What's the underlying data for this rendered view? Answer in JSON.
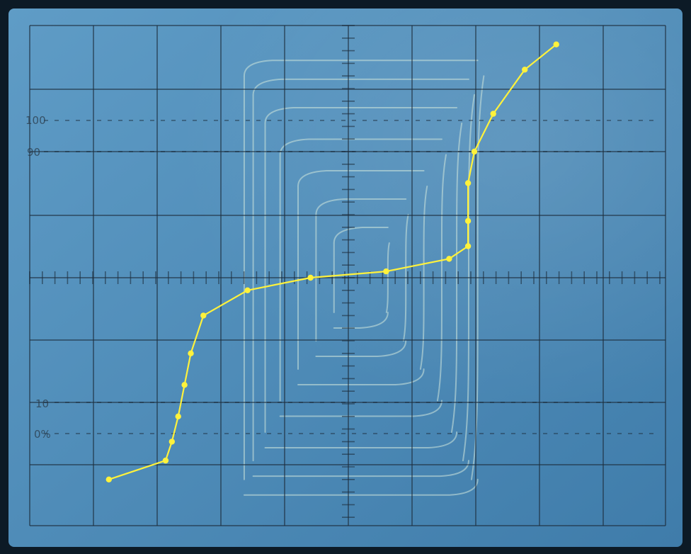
{
  "screen": {
    "labels": {
      "hundred": "100",
      "ninety": "90",
      "ten": "10",
      "zero_pct": "0%"
    },
    "colors": {
      "bezel": "#0c1a26",
      "screen_light": "#5f9cc6",
      "screen_dark": "#3f7caa",
      "graticule": "#1d2d3c",
      "trace_ghost": "#cfe6dc",
      "overlay_line": "#fff23c"
    }
  },
  "overlay_trace": {
    "color": "#fff23c",
    "points": [
      [
        -3.8,
        -3.2
      ],
      [
        -2.9,
        -2.9
      ],
      [
        -2.8,
        -2.6
      ],
      [
        -2.7,
        -2.2
      ],
      [
        -2.6,
        -1.7
      ],
      [
        -2.5,
        -1.2
      ],
      [
        -2.3,
        -0.6
      ],
      [
        -1.6,
        -0.2
      ],
      [
        -0.6,
        0.0
      ],
      [
        0.6,
        0.1
      ],
      [
        1.6,
        0.3
      ],
      [
        1.9,
        0.5
      ],
      [
        1.9,
        0.9
      ],
      [
        1.9,
        1.5
      ],
      [
        2.0,
        2.0
      ],
      [
        2.3,
        2.6
      ],
      [
        2.8,
        3.3
      ],
      [
        3.3,
        3.7
      ]
    ]
  }
}
